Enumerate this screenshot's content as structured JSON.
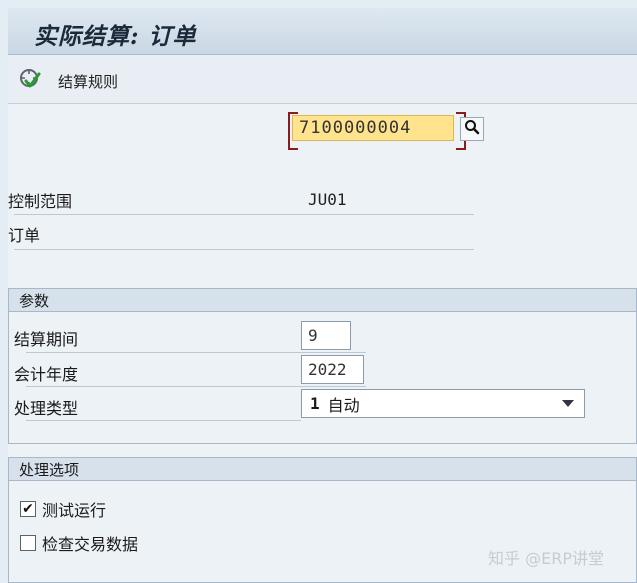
{
  "window": {
    "title": "实际结算: 订单"
  },
  "toolbar": {
    "rules_label": "结算规则"
  },
  "header": {
    "controlling_area_label": "控制范围",
    "controlling_area_value": "JU01",
    "order_label": "订单",
    "order_value": "7100000004"
  },
  "parameters": {
    "title": "参数",
    "period_label": "结算期间",
    "period_value": "9",
    "fiscal_year_label": "会计年度",
    "fiscal_year_value": "2022",
    "processing_type_label": "处理类型",
    "processing_type_key": "1",
    "processing_type_text": "自动"
  },
  "processing_options": {
    "title": "处理选项",
    "test_run_label": "测试运行",
    "test_run_checked": true,
    "check_trans_label": "检查交易数据",
    "check_trans_checked": false
  },
  "watermark": "知乎 @ERP讲堂",
  "icons": {
    "toolbar": "execute-rules-icon",
    "search": "search-icon",
    "dropdown": "chevron-down-icon"
  }
}
